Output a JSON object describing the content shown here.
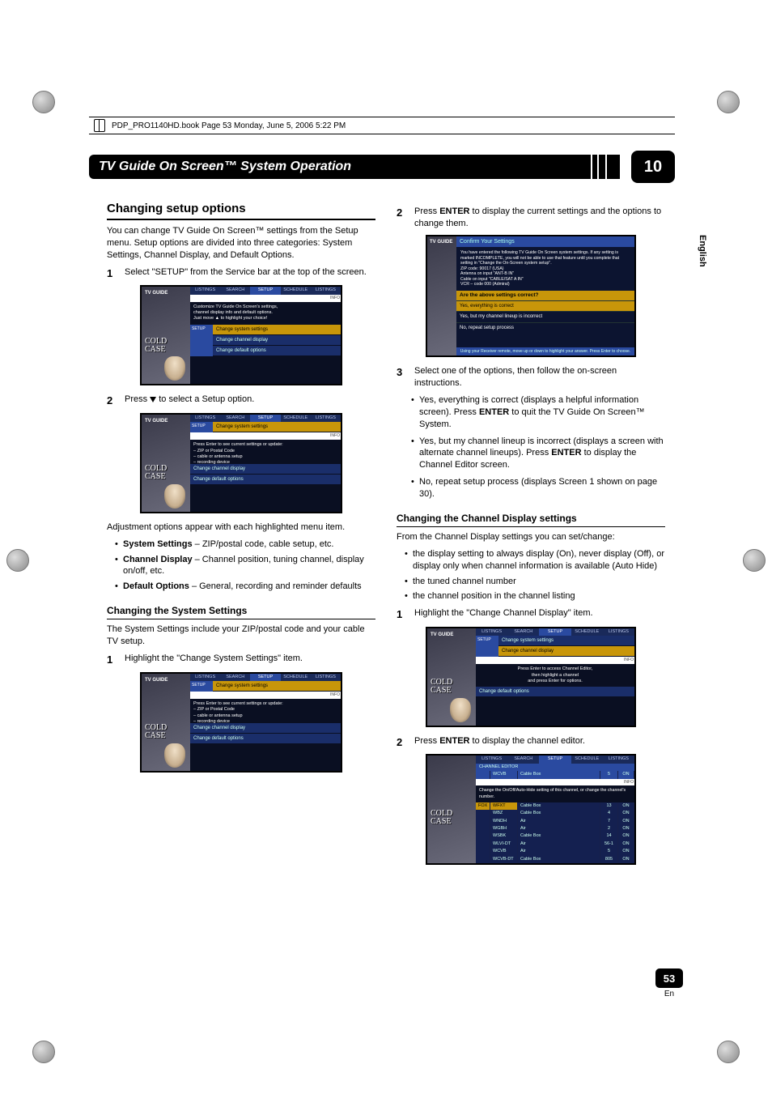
{
  "header": {
    "book_line": "PDP_PRO1140HD.book  Page 53  Monday, June 5, 2006  5:22 PM"
  },
  "chapter": {
    "title": "TV Guide On Screen™ System Operation",
    "number": "10"
  },
  "side": {
    "language": "English"
  },
  "footer": {
    "page": "53",
    "lang": "En"
  },
  "left": {
    "h_changing": "Changing setup options",
    "p_changing": "You can change TV Guide On Screen™ settings from the Setup menu. Setup options are divided into three categories: System Settings, Channel Display, and Default Options.",
    "s1_num": "1",
    "s1_text": "Select \"SETUP\" from the Service bar at the top of the screen.",
    "s2_num": "2",
    "s2_pre": "Press ",
    "s2_post": " to select a Setup option.",
    "p_adjust": "Adjustment options appear with each highlighted menu item.",
    "b1_label": "System Settings",
    "b1_rest": " – ZIP/postal code, cable setup, etc.",
    "b2_label": "Channel Display",
    "b2_rest": " – Channel position, tuning channel, display on/off, etc.",
    "b3_label": "Default Options",
    "b3_rest": " – General, recording and reminder defaults",
    "h_sys": "Changing the System Settings",
    "p_sys": "The System Settings include your ZIP/postal code and your cable TV setup.",
    "sys_s1_num": "1",
    "sys_s1_text": "Highlight the \"Change System Settings\" item."
  },
  "right": {
    "r_s2_num": "2",
    "r_s2_a": "Press ",
    "r_s2_b": "ENTER",
    "r_s2_c": " to display the current settings and the options to change them.",
    "r_s3_num": "3",
    "r_s3_text": "Select one of the options, then follow the on-screen instructions.",
    "sb1_a": "Yes, everything is correct (displays a helpful information screen). Press ",
    "sb1_b": "ENTER",
    "sb1_c": " to quit the TV Guide On Screen™ System.",
    "sb2_a": "Yes, but my channel lineup is incorrect (displays a screen with alternate channel lineups). Press ",
    "sb2_b": "ENTER",
    "sb2_c": " to display the Channel Editor screen.",
    "sb3": "No, repeat setup process (displays Screen 1 shown on page 30).",
    "h_cd": "Changing the Channel Display settings",
    "p_cd": "From the Channel Display settings you can set/change:",
    "cdb1": "the display setting to always display (On), never display (Off), or display only when channel information is available (Auto Hide)",
    "cdb2": "the tuned channel number",
    "cdb3": "the channel position in the channel listing",
    "cd_s1_num": "1",
    "cd_s1_text": "Highlight the \"Change Channel Display\" item.",
    "cd_s2_num": "2",
    "cd_s2_a": "Press ",
    "cd_s2_b": "ENTER",
    "cd_s2_c": " to display the channel editor."
  },
  "ss_common": {
    "thumb_logo": "TV GUIDE",
    "thumb_show1": "COLD",
    "thumb_show2": "CASE",
    "tabs": [
      "LISTINGS",
      "SEARCH",
      "SETUP",
      "SCHEDULE",
      "LISTINGS"
    ],
    "info": "INFO"
  },
  "ss1": {
    "panel_title": "SETUP",
    "row_sel": "Change system settings",
    "body1": "Customize TV Guide On Screen's settings,",
    "body2": "channel display info and default options.",
    "body3": "Just move ▲ to highlight your choice!",
    "row2": "Change channel display",
    "row3": "Change default options"
  },
  "ss2": {
    "panel_title": "SETUP",
    "row_sel": "Change system settings",
    "body1": "Press Enter to see current settings or update:",
    "body2": "– ZIP or Postal Code",
    "body3": "– cable or antenna setup",
    "body4": "– recording device",
    "row2": "Change channel display",
    "row3": "Change default options"
  },
  "ss3": {
    "panel_title": "SETUP",
    "row1": "Change system settings",
    "row_sel": "Change channel display",
    "body1": "Press Enter to access Channel Editor,",
    "body2": "then highlight a channel",
    "body3": "and press Enter for options.",
    "row3": "Change default options"
  },
  "confirm": {
    "title": "Confirm Your Settings",
    "l1": "You have entered the following TV Guide On Screen system settings. If any setting is marked INCOMPLETE, you will not be able to use that feature until you complete that setting in \"Change the On-Screen system setup\".",
    "l2": "ZIP code: 90017 (USA)",
    "l3": "Antenna on input \"ANT-B IN\"",
    "l4": "Cable on input \"CABLE/SAT A IN\"",
    "l5": "VCR – code 000 (Admiral)",
    "q": "Are the above settings correct?",
    "o1": "Yes, everything is correct",
    "o2": "Yes, but my channel lineup is incorrect",
    "o3": "No, repeat setup process",
    "foot": "Using your Receiver remote, move up or down to highlight your answer. Press Enter to choose."
  },
  "editor": {
    "hdr": "CHANNEL EDITOR",
    "sel_ch": "WCVB",
    "sel_src": "Cable Box",
    "sel_num": "5",
    "sel_state": "ON",
    "hint": "Change the On/Off/Auto-Hide setting of this channel, or change the channel's number.",
    "rows": [
      {
        "net": "FOX",
        "ch": "WFXT",
        "src": "Cable Box",
        "num": "13",
        "st": "ON"
      },
      {
        "net": "",
        "ch": "WBZ",
        "src": "Cable Box",
        "num": "4",
        "st": "ON"
      },
      {
        "net": "",
        "ch": "WNDH",
        "src": "Air",
        "num": "7",
        "st": "ON"
      },
      {
        "net": "",
        "ch": "WGBH",
        "src": "Air",
        "num": "2",
        "st": "ON"
      },
      {
        "net": "",
        "ch": "WSBK",
        "src": "Cable Box",
        "num": "14",
        "st": "ON"
      },
      {
        "net": "",
        "ch": "WLVI-DT",
        "src": "Air",
        "num": "56-1",
        "st": "ON"
      },
      {
        "net": "",
        "ch": "WCVB",
        "src": "Air",
        "num": "5",
        "st": "ON"
      },
      {
        "net": "",
        "ch": "WCVB-DT",
        "src": "Cable Box",
        "num": "805",
        "st": "ON"
      }
    ]
  }
}
